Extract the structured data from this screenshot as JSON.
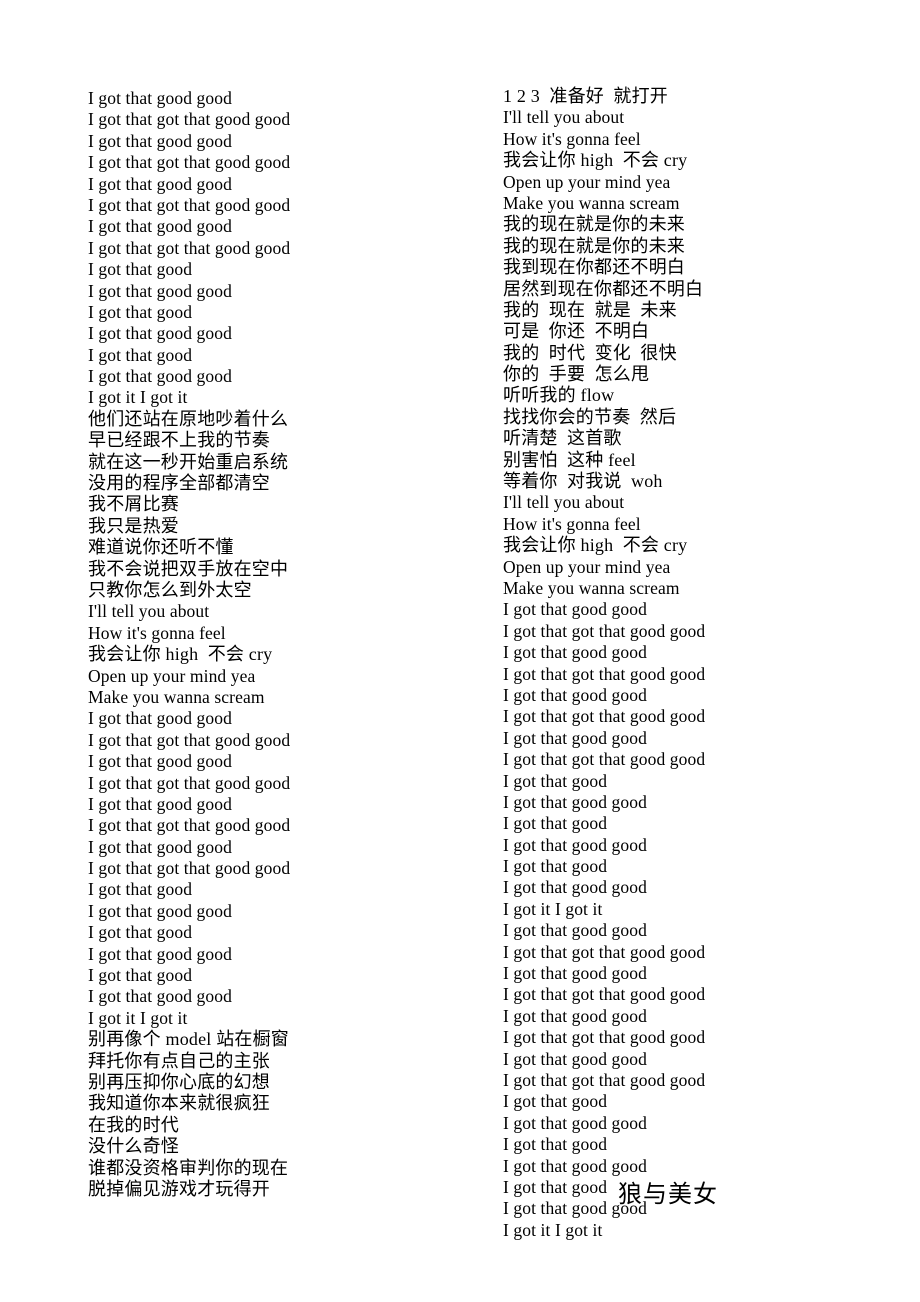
{
  "document": {
    "title": "狼与美女",
    "page_background": "#ffffff",
    "text_color": "#000000"
  },
  "song_title": "狼与美女",
  "columns": {
    "left": {
      "lines": [
        "I got that good good",
        "I got that got that good good",
        "I got that good good",
        "I got that got that good good",
        "I got that good good",
        "I got that got that good good",
        "I got that good good",
        "I got that got that good good",
        "I got that good",
        "I got that good good",
        "I got that good",
        "I got that good good",
        "I got that good",
        "I got that good good",
        "I got it I got it",
        "他们还站在原地吵着什么",
        "早已经跟不上我的节奏",
        "就在这一秒开始重启系统",
        "没用的程序全部都清空",
        "我不屑比赛",
        "我只是热爱",
        "难道说你还听不懂",
        "我不会说把双手放在空中",
        "只教你怎么到外太空",
        "I'll tell you about",
        "How it's gonna feel",
        "我会让你 high  不会 cry",
        "Open up your mind yea",
        "Make you wanna scream",
        "I got that good good",
        "I got that got that good good",
        "I got that good good",
        "I got that got that good good",
        "I got that good good",
        "I got that got that good good",
        "I got that good good",
        "I got that got that good good",
        "I got that good",
        "I got that good good",
        "I got that good",
        "I got that good good",
        "I got that good",
        "I got that good good",
        "I got it I got it",
        "别再像个 model 站在橱窗",
        "拜托你有点自己的主张",
        "别再压抑你心底的幻想",
        "我知道你本来就很疯狂",
        "在我的时代",
        "没什么奇怪",
        "谁都没资格审判你的现在",
        "脱掉偏见游戏才玩得开"
      ],
      "cjk_flags": [
        false,
        false,
        false,
        false,
        false,
        false,
        false,
        false,
        false,
        false,
        false,
        false,
        false,
        false,
        false,
        true,
        true,
        true,
        true,
        true,
        true,
        true,
        true,
        true,
        false,
        false,
        true,
        false,
        false,
        false,
        false,
        false,
        false,
        false,
        false,
        false,
        false,
        false,
        false,
        false,
        false,
        false,
        false,
        false,
        true,
        true,
        true,
        true,
        true,
        true,
        true,
        true
      ]
    },
    "right": {
      "lines": [
        "1 2 3  准备好  就打开",
        "I'll tell you about",
        "How it's gonna feel",
        "我会让你 high  不会 cry",
        "Open up your mind yea",
        "Make you wanna scream",
        "我的现在就是你的未来",
        "我的现在就是你的未来",
        "我到现在你都还不明白",
        "居然到现在你都还不明白",
        "我的  现在  就是  未来",
        "可是  你还  不明白",
        "我的  时代  变化  很快",
        "你的  手要  怎么甩",
        "听听我的 flow",
        "找找你会的节奏  然后",
        "听清楚  这首歌",
        "别害怕  这种 feel",
        "等着你  对我说  woh",
        "I'll tell you about",
        "How it's gonna feel",
        "我会让你 high  不会 cry",
        "Open up your mind yea",
        "Make you wanna scream",
        "I got that good good",
        "I got that got that good good",
        "I got that good good",
        "I got that got that good good",
        "I got that good good",
        "I got that got that good good",
        "I got that good good",
        "I got that got that good good",
        "I got that good",
        "I got that good good",
        "I got that good",
        "I got that good good",
        "I got that good",
        "I got that good good",
        "I got it I got it",
        "I got that good good",
        "I got that got that good good",
        "I got that good good",
        "I got that got that good good",
        "I got that good good",
        "I got that got that good good",
        "I got that good good",
        "I got that got that good good",
        "I got that good",
        "I got that good good",
        "I got that good",
        "I got that good good",
        "I got that good",
        "I got that good good",
        "I got it I got it"
      ],
      "cjk_flags": [
        true,
        false,
        false,
        true,
        false,
        false,
        true,
        true,
        true,
        true,
        true,
        true,
        true,
        true,
        true,
        true,
        true,
        true,
        true,
        false,
        false,
        true,
        false,
        false,
        false,
        false,
        false,
        false,
        false,
        false,
        false,
        false,
        false,
        false,
        false,
        false,
        false,
        false,
        false,
        false,
        false,
        false,
        false,
        false,
        false,
        false,
        false,
        false,
        false,
        false,
        false,
        false,
        false,
        false
      ]
    }
  }
}
